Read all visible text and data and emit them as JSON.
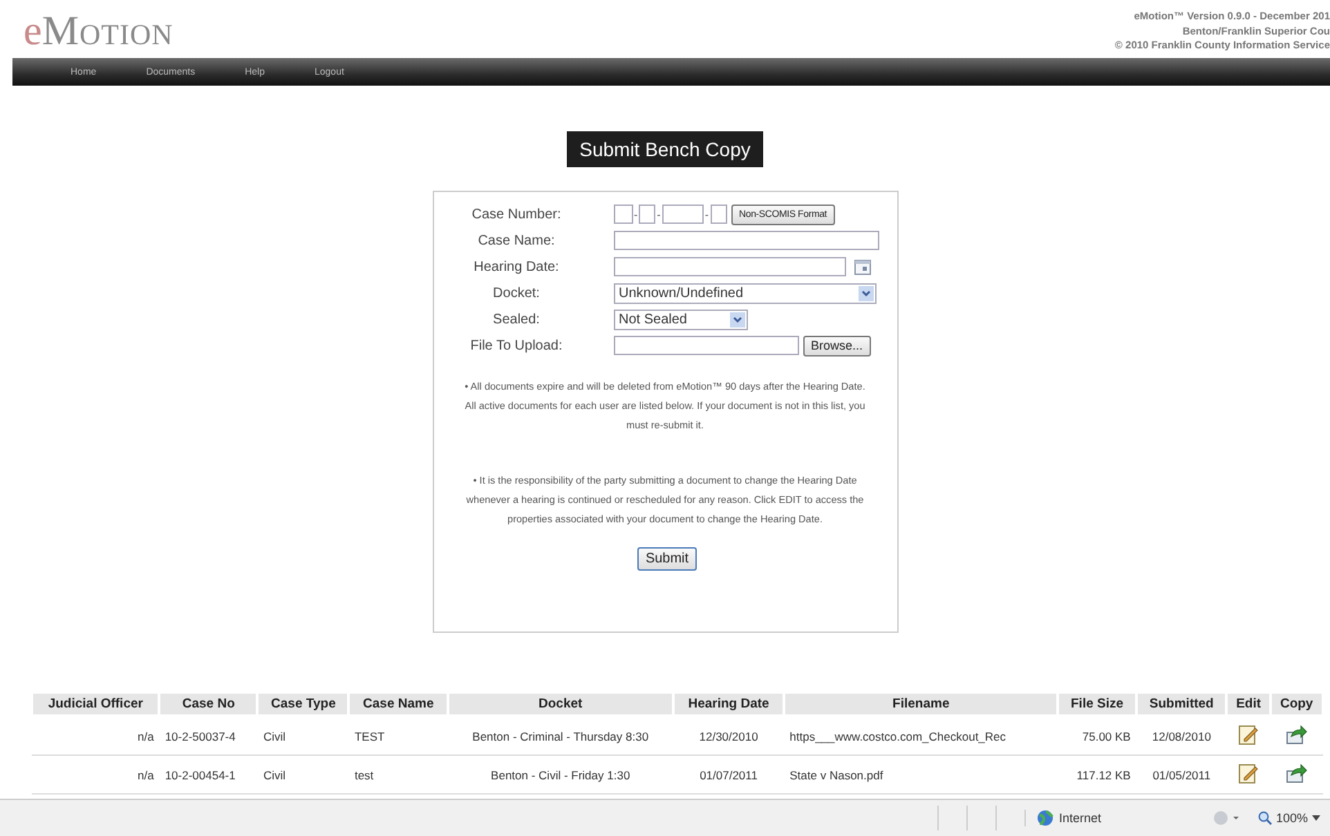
{
  "header": {
    "logo_first": "e",
    "logo_rest": "Motion",
    "version_lines": [
      "eMotion™ Version 0.9.0 - December 201",
      "Benton/Franklin Superior Cou",
      "© 2010 Franklin County Information Service"
    ]
  },
  "nav": [
    "Home",
    "Documents",
    "Help",
    "Logout"
  ],
  "title": "Submit Bench Copy",
  "form": {
    "case_number_label": "Case Number:",
    "case_number_separators": [
      "-",
      "-",
      "-"
    ],
    "format_button": "Non-SCOMIS Format",
    "case_name_label": "Case Name:",
    "hearing_date_label": "Hearing Date:",
    "docket_label": "Docket:",
    "docket_value": "Unknown/Undefined",
    "sealed_label": "Sealed:",
    "sealed_value": "Not Sealed",
    "file_label": "File To Upload:",
    "browse_button": "Browse...",
    "notes": [
      "• All documents expire and will be deleted from eMotion™ 90 days after the Hearing Date. All active documents for each user are listed below. If your document is not in this list, you must re-submit it.",
      "• It is the responsibility of the party submitting a document to change the Hearing Date whenever a hearing is continued or rescheduled for any reason. Click EDIT to access the properties associated with your document to change the Hearing Date."
    ],
    "submit_button": "Submit"
  },
  "table": {
    "columns": [
      "Judicial Officer",
      "Case No",
      "Case Type",
      "Case Name",
      "Docket",
      "Hearing Date",
      "Filename",
      "File Size",
      "Submitted",
      "Edit",
      "Copy"
    ],
    "rows": [
      [
        "n/a",
        "10-2-50037-4",
        "Civil",
        "TEST",
        "Benton - Criminal - Thursday 8:30",
        "12/30/2010",
        "https___www.costco.com_Checkout_Rec",
        "75.00 KB",
        "12/08/2010"
      ],
      [
        "n/a",
        "10-2-00454-1",
        "Civil",
        "test",
        "Benton - Civil - Friday 1:30",
        "01/07/2011",
        "State v Nason.pdf",
        "117.12 KB",
        "01/05/2011"
      ]
    ]
  },
  "status_bar": {
    "zone": "Internet",
    "zoom": "100%"
  }
}
